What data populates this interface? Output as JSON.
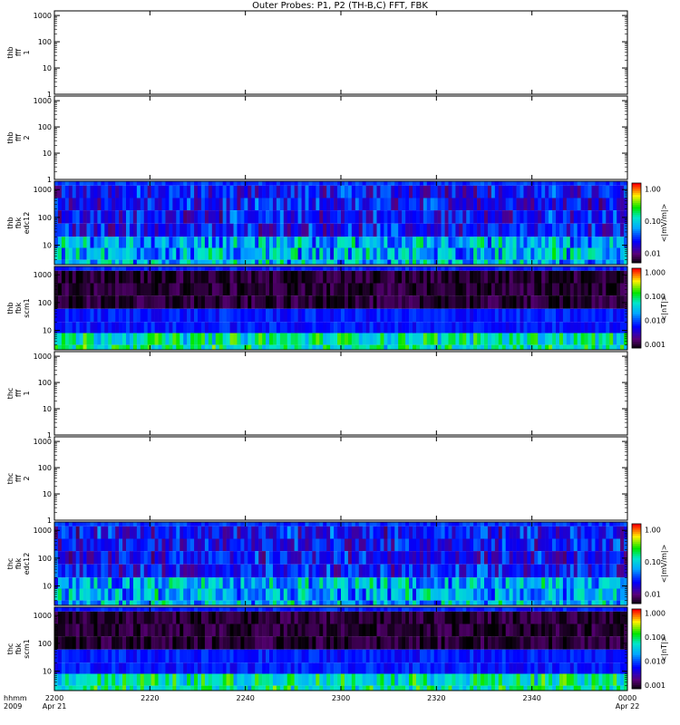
{
  "title": "Outer Probes: P1, P2 (TH-B,C) FFT, FBK",
  "chart_data": {
    "type": "heatmap",
    "x_ticks": [
      "2200",
      "2220",
      "2240",
      "2300",
      "2320",
      "2340",
      "0000"
    ],
    "x_date_labels": {
      "left": "Apr 21",
      "right": "Apr 22"
    },
    "x_row_labels": [
      "hhmm",
      "2009"
    ],
    "y_ticks": [
      "1",
      "10",
      "100",
      "1000"
    ],
    "y_scale": "log",
    "panels": [
      {
        "id": "thb-fff-1",
        "label_lines": [
          "thb",
          "fff",
          "1"
        ],
        "yticks": [
          "1",
          "10",
          "100",
          "1000"
        ],
        "ylim": [
          1,
          1500
        ],
        "has_data": false
      },
      {
        "id": "thb-fff-2",
        "label_lines": [
          "thb",
          "fff",
          "2"
        ],
        "yticks": [
          "1",
          "10",
          "100",
          "1000"
        ],
        "ylim": [
          1,
          1500
        ],
        "has_data": false
      },
      {
        "id": "thb-fbk-edc12",
        "label_lines": [
          "thb",
          "fbk",
          "edc12"
        ],
        "yticks": [
          "10",
          "100",
          "1000"
        ],
        "ylim": [
          2,
          2000
        ],
        "has_data": true,
        "colorbar": {
          "unit": "<|mV/m|>",
          "ticks": [
            "1.00",
            "0.10",
            "0.01"
          ],
          "range": [
            0.005,
            1.5
          ]
        }
      },
      {
        "id": "thb-fbk-scm1",
        "label_lines": [
          "thb",
          "fbk",
          "scm1"
        ],
        "yticks": [
          "10",
          "100",
          "1000"
        ],
        "ylim": [
          2,
          2000
        ],
        "has_data": true,
        "colorbar": {
          "unit": "<|nT|>",
          "ticks": [
            "1.000",
            "0.100",
            "0.010",
            "0.001"
          ],
          "range": [
            0.0007,
            1.5
          ]
        }
      },
      {
        "id": "thc-fff-1",
        "label_lines": [
          "thc",
          "fff",
          "1"
        ],
        "yticks": [
          "1",
          "10",
          "100",
          "1000"
        ],
        "ylim": [
          1,
          1500
        ],
        "has_data": false
      },
      {
        "id": "thc-fff-2",
        "label_lines": [
          "thc",
          "fff",
          "2"
        ],
        "yticks": [
          "1",
          "10",
          "100",
          "1000"
        ],
        "ylim": [
          1,
          1500
        ],
        "has_data": false
      },
      {
        "id": "thc-fbk-edc12",
        "label_lines": [
          "thc",
          "fbk",
          "edc12"
        ],
        "yticks": [
          "10",
          "100",
          "1000"
        ],
        "ylim": [
          2,
          2000
        ],
        "has_data": true,
        "colorbar": {
          "unit": "<|mV/m|>",
          "ticks": [
            "1.00",
            "0.10",
            "0.01"
          ],
          "range": [
            0.005,
            1.5
          ]
        }
      },
      {
        "id": "thc-fbk-scm1",
        "label_lines": [
          "thc",
          "fbk",
          "scm1"
        ],
        "yticks": [
          "10",
          "100",
          "1000"
        ],
        "ylim": [
          2,
          2000
        ],
        "has_data": true,
        "colorbar": {
          "unit": "<|nT|>",
          "ticks": [
            "1.000",
            "0.100",
            "0.010",
            "0.001"
          ],
          "range": [
            0.0007,
            1.5
          ]
        }
      }
    ]
  }
}
